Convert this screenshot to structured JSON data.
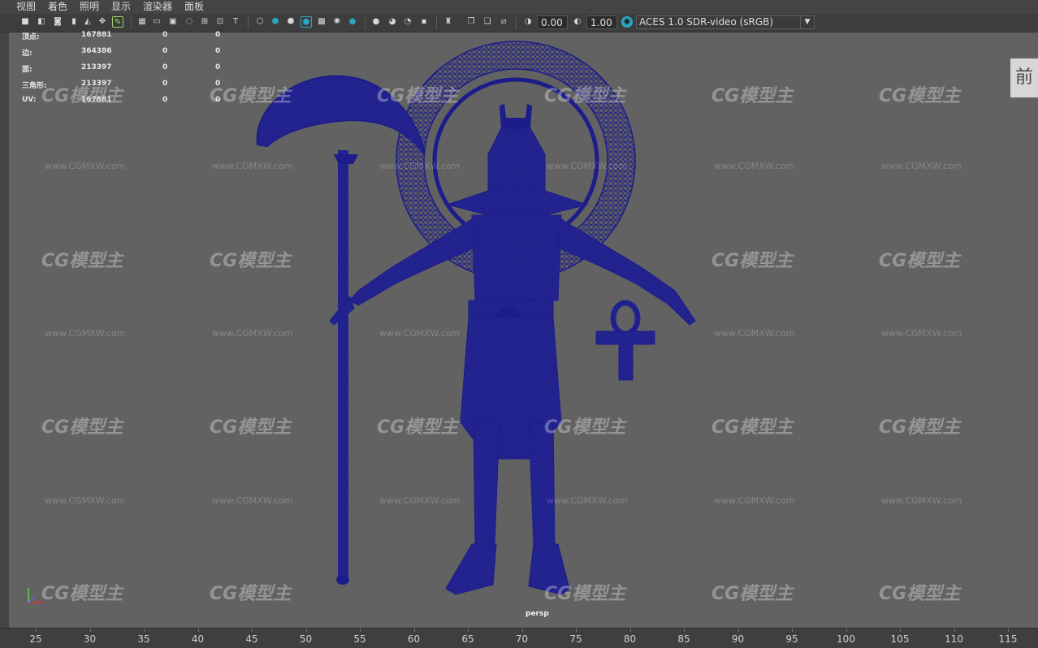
{
  "menu": [
    "视图",
    "着色",
    "照明",
    "显示",
    "渲染器",
    "面板"
  ],
  "toolbar": {
    "exposure_value": "0.00",
    "gamma_value": "1.00",
    "color_space": "ACES 1.0 SDR-video (sRGB)",
    "icons": [
      "camera-select-icon",
      "camera-attr-icon",
      "bookmark-icon",
      "image-plane-icon",
      "2d-pan-icon",
      "grease-pencil-icon",
      "grid-icon",
      "film-gate-icon",
      "resolution-gate-icon",
      "gate-mask-icon",
      "field-chart-icon",
      "safe-action-icon",
      "safe-title-icon",
      "wireframe-icon",
      "smooth-shade-icon",
      "wireframe-on-shaded-icon",
      "textured-icon",
      "lights-icon",
      "shadows-icon",
      "ambient-occlusion-icon",
      "motion-blur-icon",
      "anti-aliasing-icon",
      "depth-of-field-icon",
      "isolate-select-icon",
      "xray-icon",
      "xray-joints-icon",
      "xray-active-icon",
      "exposure-icon",
      "gamma-icon",
      "view-transform-icon"
    ]
  },
  "stats": {
    "rows": [
      {
        "label": "顶点:",
        "a": "167881",
        "b": "0",
        "c": "0"
      },
      {
        "label": "边:",
        "a": "364386",
        "b": "0",
        "c": "0"
      },
      {
        "label": "面:",
        "a": "213397",
        "b": "0",
        "c": "0"
      },
      {
        "label": "三角形:",
        "a": "213397",
        "b": "0",
        "c": "0"
      },
      {
        "label": "UV:",
        "a": "167881",
        "b": "0",
        "c": "0"
      }
    ]
  },
  "watermark": {
    "logo": "CG模型主",
    "url": "www.CGMXW.com"
  },
  "camera_label": "persp",
  "view_cube_label": "前",
  "ruler_ticks": [
    "25",
    "30",
    "35",
    "40",
    "45",
    "50",
    "55",
    "60",
    "65",
    "70",
    "75",
    "80",
    "85",
    "90",
    "95",
    "100",
    "105",
    "110",
    "115"
  ],
  "colors": {
    "wire": "#1c1c8a",
    "viewport_bg": "#626262",
    "accent": "#29a7c4"
  }
}
